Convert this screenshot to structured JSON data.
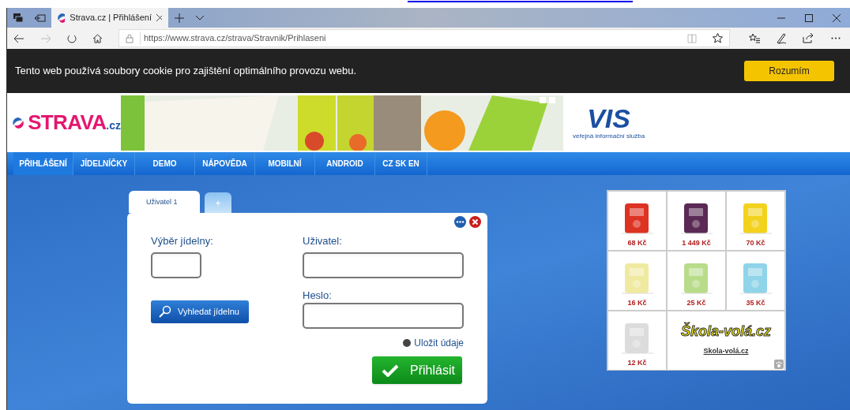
{
  "browser": {
    "tabs": [
      {
        "title": "Strava.cz | Přihlášení",
        "selected": true
      }
    ],
    "url": "https://www.strava.cz/strava/Stravnik/Prihlaseni"
  },
  "cookie_bar": {
    "text": "Tento web používá soubory cookie pro zajištění optimálního provozu webu.",
    "button": "Rozumím"
  },
  "header": {
    "logo": "STRAVA",
    "logo_suffix": ".cz",
    "partner_logo": "VIS",
    "partner_tagline": "veřejná informační služba"
  },
  "nav": [
    {
      "label": "PŘIHLÁŠENÍ",
      "selected": true
    },
    {
      "label": "JÍDELNÍČKY",
      "selected": false
    },
    {
      "label": "DEMO",
      "selected": false
    },
    {
      "label": "NÁPOVĚDA",
      "selected": false
    },
    {
      "label": "MOBILNÍ",
      "selected": false
    },
    {
      "label": "ANDROID",
      "selected": false
    },
    {
      "label": "CZ SK EN",
      "selected": false
    }
  ],
  "login": {
    "tabs": [
      {
        "label": "Uživatel 1",
        "selected": true
      },
      {
        "label": "+",
        "selected": false
      }
    ],
    "canteen_label": "Výběr jídelny:",
    "search_button": "Vyhledat jídelnu",
    "user_label": "Uživatel:",
    "password_label": "Heslo:",
    "remember": {
      "label": "Uložit údaje",
      "checked": false
    },
    "submit": "Přihlásit"
  },
  "products": [
    {
      "price": "68 Kč"
    },
    {
      "price": "1 449 Kč"
    },
    {
      "price": "70 Kč"
    },
    {
      "price": "16 Kč"
    },
    {
      "price": "25 Kč"
    },
    {
      "price": "35 Kč"
    },
    {
      "price": "12 Kč"
    }
  ],
  "promo": {
    "logo": "Škola-volá.cz",
    "link": "Skola-volá.cz"
  }
}
